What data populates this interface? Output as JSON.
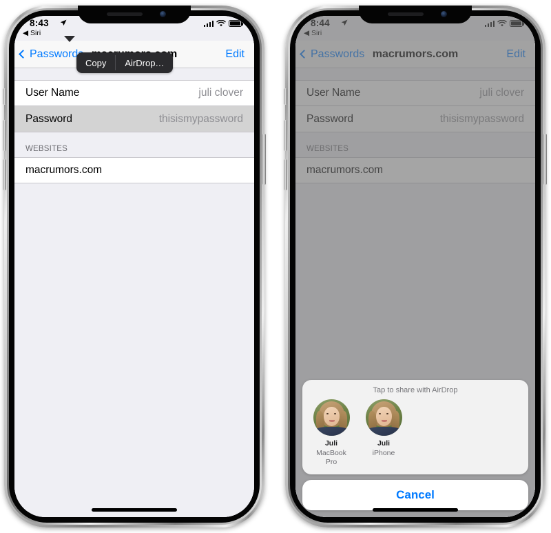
{
  "screens": [
    {
      "id": "left",
      "status": {
        "time": "8:43",
        "location_icon": "location-arrow-icon",
        "back_app": "◀ Siri",
        "signal_icon": "cellular-bars-icon",
        "wifi_icon": "wifi-icon",
        "battery_icon": "battery-icon"
      },
      "nav": {
        "back_label": "Passwords",
        "title": "macrumors.com",
        "edit_label": "Edit"
      },
      "rows": [
        {
          "label": "User Name",
          "value": "juli clover",
          "selected": false
        },
        {
          "label": "Password",
          "value": "thisismypassword",
          "selected": true
        }
      ],
      "section": {
        "header": "WEBSITES",
        "items": [
          {
            "label": "macrumors.com"
          }
        ]
      },
      "popover": {
        "visible": true,
        "copy_label": "Copy",
        "airdrop_label": "AirDrop…"
      },
      "sheet": {
        "visible": false
      }
    },
    {
      "id": "right",
      "status": {
        "time": "8:44",
        "location_icon": "location-arrow-icon",
        "back_app": "◀ Siri",
        "signal_icon": "cellular-bars-icon",
        "wifi_icon": "wifi-icon",
        "battery_icon": "battery-icon"
      },
      "nav": {
        "back_label": "Passwords",
        "title": "macrumors.com",
        "edit_label": "Edit"
      },
      "rows": [
        {
          "label": "User Name",
          "value": "juli clover",
          "selected": false
        },
        {
          "label": "Password",
          "value": "thisismypassword",
          "selected": false
        }
      ],
      "section": {
        "header": "WEBSITES",
        "items": [
          {
            "label": "macrumors.com"
          }
        ]
      },
      "popover": {
        "visible": false
      },
      "sheet": {
        "visible": true,
        "title": "Tap to share with AirDrop",
        "targets": [
          {
            "name": "Juli",
            "device": "MacBook Pro",
            "avatar": "avatar-photo"
          },
          {
            "name": "Juli",
            "device": "iPhone",
            "avatar": "avatar-photo"
          }
        ],
        "cancel_label": "Cancel"
      }
    }
  ],
  "colors": {
    "accent": "#007aff",
    "selected_row": "#d3d3d3",
    "group_bg": "#efeff4",
    "cell_bg": "#ffffff",
    "popover_bg": "#2b2b2e",
    "sheet_bg": "#f2f2f2",
    "separator": "#c8c7cc",
    "secondary_text": "#8e8e93"
  }
}
